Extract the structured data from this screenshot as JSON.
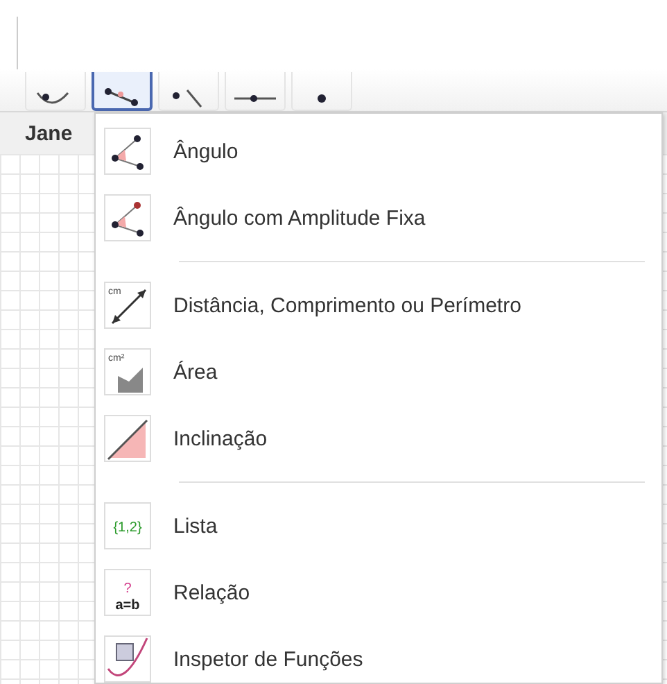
{
  "toolbar": {
    "tools": [
      {
        "kind": "conic",
        "selected": false
      },
      {
        "kind": "angle",
        "selected": true
      },
      {
        "kind": "reflect",
        "selected": false
      },
      {
        "kind": "slider",
        "selected": false
      },
      {
        "kind": "move",
        "selected": false
      }
    ]
  },
  "view_header": {
    "title": "Jane"
  },
  "menu": {
    "sections": [
      [
        {
          "kind": "angle",
          "label": "Ângulo"
        },
        {
          "kind": "angle-fixed",
          "label": "Ângulo com Amplitude Fixa"
        }
      ],
      [
        {
          "kind": "distance",
          "label": "Distância, Comprimento ou Perímetro",
          "icon_text": "cm"
        },
        {
          "kind": "area",
          "label": "Área",
          "icon_text": "cm²"
        },
        {
          "kind": "slope",
          "label": "Inclinação"
        }
      ],
      [
        {
          "kind": "list",
          "label": "Lista",
          "icon_text": "{1,2}"
        },
        {
          "kind": "relation",
          "label": "Relação",
          "icon_text": "a=b",
          "icon_mark": "?"
        },
        {
          "kind": "inspector",
          "label": "Inspetor de Funções"
        }
      ]
    ]
  }
}
